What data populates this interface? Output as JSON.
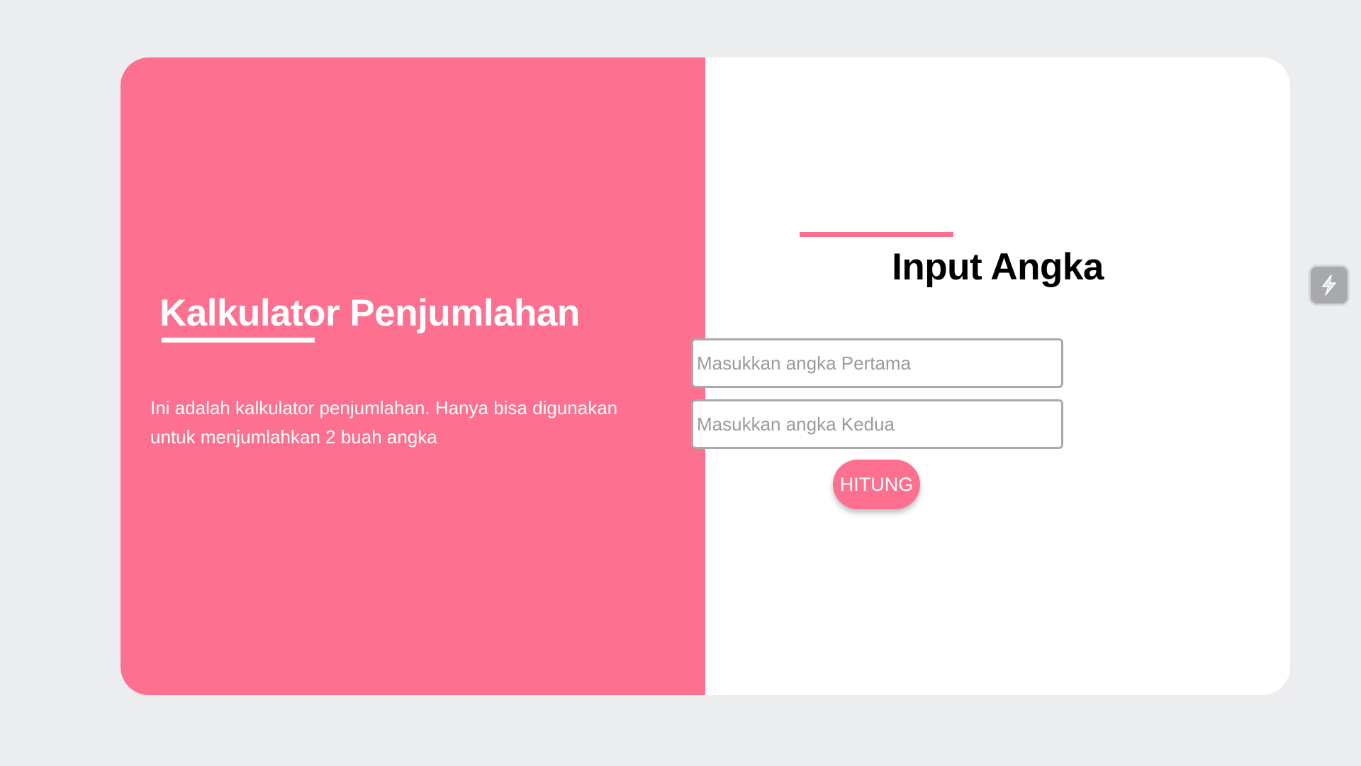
{
  "colors": {
    "background": "#ecedef",
    "accent": "#fd7090",
    "panel": "#ffffff"
  },
  "left_panel": {
    "title": "Kalkulator Penjumlahan",
    "description": "Ini adalah kalkulator penjumlahan. Hanya bisa digunakan untuk menjumlahkan 2 buah angka"
  },
  "form": {
    "title": "Input Angka",
    "first_input": {
      "value": "",
      "placeholder": "Masukkan angka Pertama"
    },
    "second_input": {
      "value": "",
      "placeholder": "Masukkan angka Kedua"
    },
    "submit_label": "HITUNG"
  },
  "extension_widget": {
    "icon": "lightning-icon"
  }
}
